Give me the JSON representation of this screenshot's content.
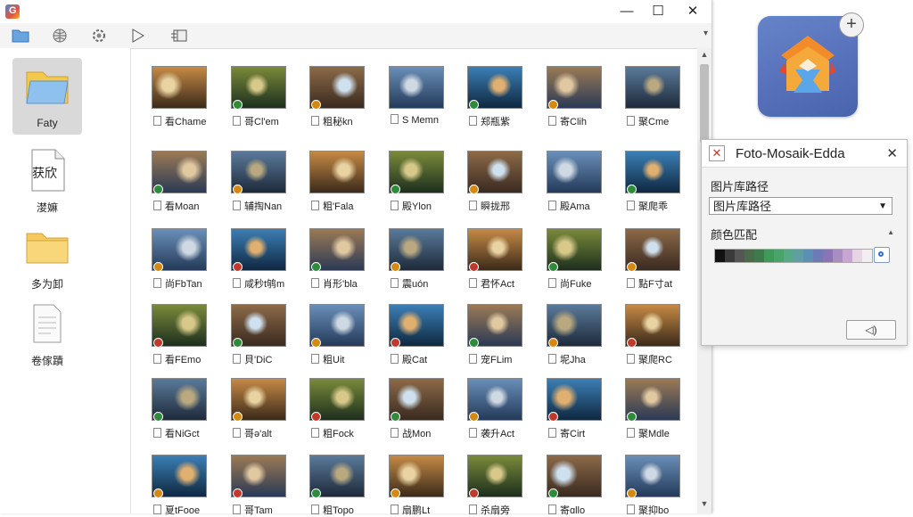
{
  "window": {
    "minimize": "—",
    "maximize": "☐",
    "close": "✕"
  },
  "toolbar": {
    "buttons": [
      "folder-icon",
      "globe-icon",
      "settings-icon",
      "play-icon",
      "filmstrip-icon"
    ],
    "extra": "▾"
  },
  "sidebar": {
    "items": [
      {
        "label": "Faty",
        "icon": "folder-blue-icon"
      },
      {
        "label": "漤嫲",
        "icon": "document-icon",
        "icon_text": "获欣"
      },
      {
        "label": "多为卸",
        "icon": "folder-yellow-icon"
      },
      {
        "label": "卷傢蹟",
        "icon": "file-icon"
      }
    ]
  },
  "grid": {
    "captions": [
      "看Chame",
      "哥Cl'em",
      "粗秘kn",
      "S Memn",
      "郑瓶紫",
      "寄Clih",
      "聚Cme",
      "看Moan",
      "辅掏Nan",
      "粗'Fala",
      "殿Ylon",
      "瞬拢邢",
      "殿Ama",
      "聚爬乖",
      "尚FbTan",
      "咸秒t鸲m",
      "肖形'bla",
      "震uón",
      "君怀Act",
      "尚Fuke",
      "點F寸at",
      "看FEmo",
      "貝'DiC",
      "粗Uit",
      "殿Cat",
      "宠FLim",
      "坭Jha",
      "聚爬RC",
      "看NiGct",
      "哥ə'alt",
      "粗Fock",
      "战Mon",
      "袭升Act",
      "寄Cirt",
      "聚Mdle",
      "夏tFooe",
      "哥Tam",
      "粗Topo",
      "扇鹏Lt",
      "杀扇旁",
      "寄ɑllo",
      "聚抑bo"
    ],
    "badge_colors": [
      "#c0392b",
      "#2e8b3a",
      "#d68910"
    ]
  },
  "dialog": {
    "title": "Foto-Mosaik-Edda",
    "close": "✕",
    "library_label": "图片库路径",
    "library_value": "图片库路径",
    "color_label": "颜色匹配",
    "button_label": "◁)",
    "palette": [
      "#111111",
      "#3a3a3a",
      "#555555",
      "#4a6a4a",
      "#3d7a4d",
      "#3e9a5a",
      "#4aa36a",
      "#57a886",
      "#5f9fa3",
      "#5c8fb5",
      "#6f79b6",
      "#8b74b5",
      "#a98cc0",
      "#c7a6cf",
      "#e6d3e4",
      "#f2eef2"
    ]
  }
}
